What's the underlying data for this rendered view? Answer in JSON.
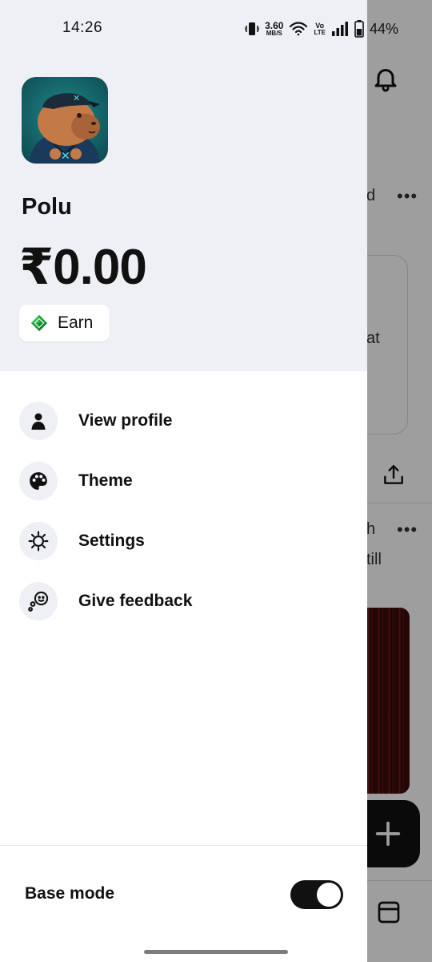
{
  "status_bar": {
    "time": "14:26",
    "net_speed_value": "3.60",
    "net_speed_unit": "MB/S",
    "volte_top": "Vo",
    "volte_bottom": "LTE",
    "battery": "44%",
    "icons": [
      "vibrate-icon",
      "wifi-icon",
      "volte-icon",
      "signal-icon",
      "battery-icon"
    ]
  },
  "background_app": {
    "snippet_1": "d",
    "snippet_2": "at",
    "snippet_3": "h",
    "snippet_4": "till",
    "more_label": "•••",
    "icons": [
      "bell-icon",
      "share-icon",
      "plus-icon",
      "tab-icon"
    ]
  },
  "drawer": {
    "username": "Polu",
    "balance": "₹0.00",
    "earn_label": "Earn",
    "menu": [
      {
        "label": "View profile",
        "icon": "person-icon"
      },
      {
        "label": "Theme",
        "icon": "palette-icon"
      },
      {
        "label": "Settings",
        "icon": "gear-icon"
      },
      {
        "label": "Give feedback",
        "icon": "feedback-icon"
      }
    ],
    "base_mode_label": "Base mode",
    "base_mode_on": true
  },
  "colors": {
    "header_bg": "#eef0f5",
    "earn_icon_green": "#1e9e3a",
    "toggle_on": "#111111"
  }
}
